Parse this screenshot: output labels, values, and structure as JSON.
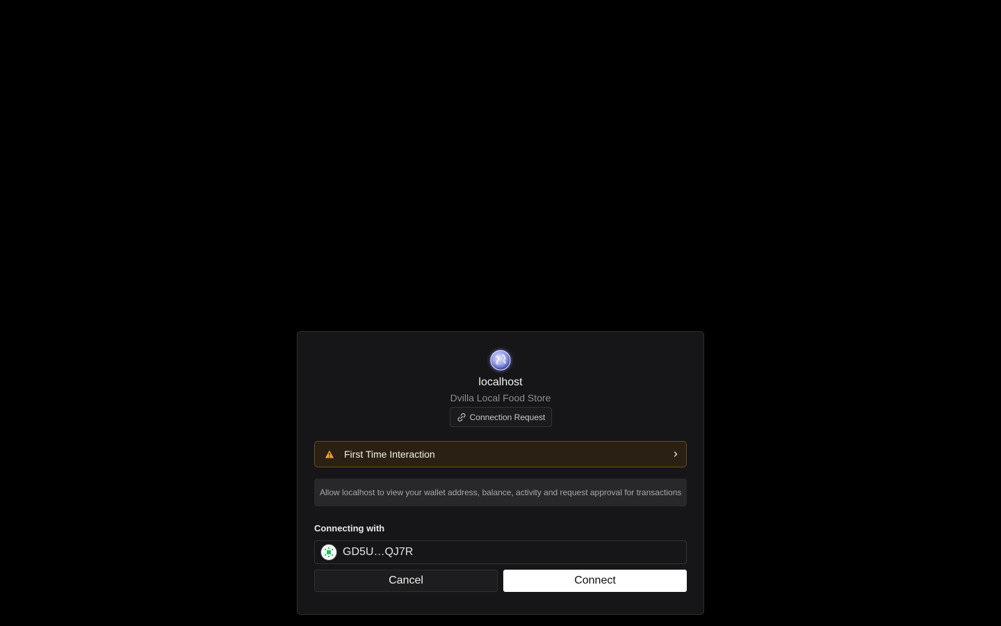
{
  "site": {
    "host": "localhost",
    "name": "Dvilla Local Food Store",
    "badge_label": "Connection Request"
  },
  "warning": {
    "label": "First Time Interaction",
    "color": "#f5a524"
  },
  "permission_description": "Allow localhost to view your wallet address, balance, activity and request approval for transactions",
  "account": {
    "section_label": "Connecting with",
    "address": "GD5U…QJ7R"
  },
  "actions": {
    "cancel_label": "Cancel",
    "connect_label": "Connect"
  }
}
